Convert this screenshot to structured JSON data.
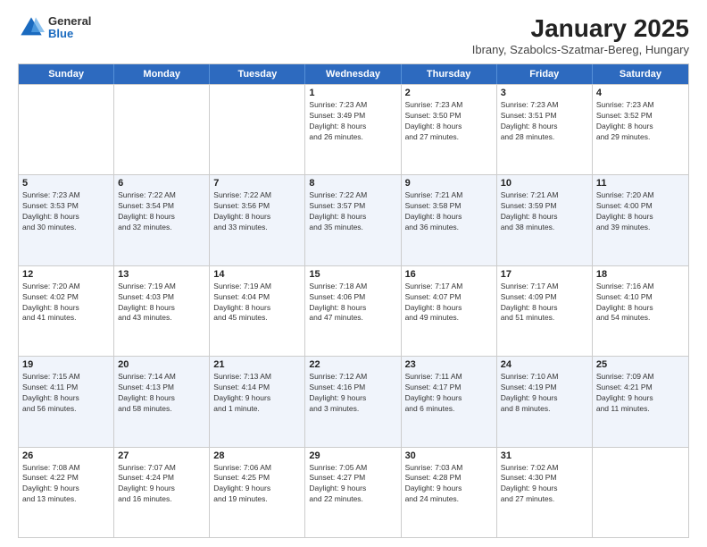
{
  "header": {
    "logo": {
      "general": "General",
      "blue": "Blue"
    },
    "title": "January 2025",
    "subtitle": "Ibrany, Szabolcs-Szatmar-Bereg, Hungary"
  },
  "days_of_week": [
    "Sunday",
    "Monday",
    "Tuesday",
    "Wednesday",
    "Thursday",
    "Friday",
    "Saturday"
  ],
  "weeks": [
    [
      {
        "day": "",
        "info": ""
      },
      {
        "day": "",
        "info": ""
      },
      {
        "day": "",
        "info": ""
      },
      {
        "day": "1",
        "info": "Sunrise: 7:23 AM\nSunset: 3:49 PM\nDaylight: 8 hours\nand 26 minutes."
      },
      {
        "day": "2",
        "info": "Sunrise: 7:23 AM\nSunset: 3:50 PM\nDaylight: 8 hours\nand 27 minutes."
      },
      {
        "day": "3",
        "info": "Sunrise: 7:23 AM\nSunset: 3:51 PM\nDaylight: 8 hours\nand 28 minutes."
      },
      {
        "day": "4",
        "info": "Sunrise: 7:23 AM\nSunset: 3:52 PM\nDaylight: 8 hours\nand 29 minutes."
      }
    ],
    [
      {
        "day": "5",
        "info": "Sunrise: 7:23 AM\nSunset: 3:53 PM\nDaylight: 8 hours\nand 30 minutes."
      },
      {
        "day": "6",
        "info": "Sunrise: 7:22 AM\nSunset: 3:54 PM\nDaylight: 8 hours\nand 32 minutes."
      },
      {
        "day": "7",
        "info": "Sunrise: 7:22 AM\nSunset: 3:56 PM\nDaylight: 8 hours\nand 33 minutes."
      },
      {
        "day": "8",
        "info": "Sunrise: 7:22 AM\nSunset: 3:57 PM\nDaylight: 8 hours\nand 35 minutes."
      },
      {
        "day": "9",
        "info": "Sunrise: 7:21 AM\nSunset: 3:58 PM\nDaylight: 8 hours\nand 36 minutes."
      },
      {
        "day": "10",
        "info": "Sunrise: 7:21 AM\nSunset: 3:59 PM\nDaylight: 8 hours\nand 38 minutes."
      },
      {
        "day": "11",
        "info": "Sunrise: 7:20 AM\nSunset: 4:00 PM\nDaylight: 8 hours\nand 39 minutes."
      }
    ],
    [
      {
        "day": "12",
        "info": "Sunrise: 7:20 AM\nSunset: 4:02 PM\nDaylight: 8 hours\nand 41 minutes."
      },
      {
        "day": "13",
        "info": "Sunrise: 7:19 AM\nSunset: 4:03 PM\nDaylight: 8 hours\nand 43 minutes."
      },
      {
        "day": "14",
        "info": "Sunrise: 7:19 AM\nSunset: 4:04 PM\nDaylight: 8 hours\nand 45 minutes."
      },
      {
        "day": "15",
        "info": "Sunrise: 7:18 AM\nSunset: 4:06 PM\nDaylight: 8 hours\nand 47 minutes."
      },
      {
        "day": "16",
        "info": "Sunrise: 7:17 AM\nSunset: 4:07 PM\nDaylight: 8 hours\nand 49 minutes."
      },
      {
        "day": "17",
        "info": "Sunrise: 7:17 AM\nSunset: 4:09 PM\nDaylight: 8 hours\nand 51 minutes."
      },
      {
        "day": "18",
        "info": "Sunrise: 7:16 AM\nSunset: 4:10 PM\nDaylight: 8 hours\nand 54 minutes."
      }
    ],
    [
      {
        "day": "19",
        "info": "Sunrise: 7:15 AM\nSunset: 4:11 PM\nDaylight: 8 hours\nand 56 minutes."
      },
      {
        "day": "20",
        "info": "Sunrise: 7:14 AM\nSunset: 4:13 PM\nDaylight: 8 hours\nand 58 minutes."
      },
      {
        "day": "21",
        "info": "Sunrise: 7:13 AM\nSunset: 4:14 PM\nDaylight: 9 hours\nand 1 minute."
      },
      {
        "day": "22",
        "info": "Sunrise: 7:12 AM\nSunset: 4:16 PM\nDaylight: 9 hours\nand 3 minutes."
      },
      {
        "day": "23",
        "info": "Sunrise: 7:11 AM\nSunset: 4:17 PM\nDaylight: 9 hours\nand 6 minutes."
      },
      {
        "day": "24",
        "info": "Sunrise: 7:10 AM\nSunset: 4:19 PM\nDaylight: 9 hours\nand 8 minutes."
      },
      {
        "day": "25",
        "info": "Sunrise: 7:09 AM\nSunset: 4:21 PM\nDaylight: 9 hours\nand 11 minutes."
      }
    ],
    [
      {
        "day": "26",
        "info": "Sunrise: 7:08 AM\nSunset: 4:22 PM\nDaylight: 9 hours\nand 13 minutes."
      },
      {
        "day": "27",
        "info": "Sunrise: 7:07 AM\nSunset: 4:24 PM\nDaylight: 9 hours\nand 16 minutes."
      },
      {
        "day": "28",
        "info": "Sunrise: 7:06 AM\nSunset: 4:25 PM\nDaylight: 9 hours\nand 19 minutes."
      },
      {
        "day": "29",
        "info": "Sunrise: 7:05 AM\nSunset: 4:27 PM\nDaylight: 9 hours\nand 22 minutes."
      },
      {
        "day": "30",
        "info": "Sunrise: 7:03 AM\nSunset: 4:28 PM\nDaylight: 9 hours\nand 24 minutes."
      },
      {
        "day": "31",
        "info": "Sunrise: 7:02 AM\nSunset: 4:30 PM\nDaylight: 9 hours\nand 27 minutes."
      },
      {
        "day": "",
        "info": ""
      }
    ]
  ]
}
